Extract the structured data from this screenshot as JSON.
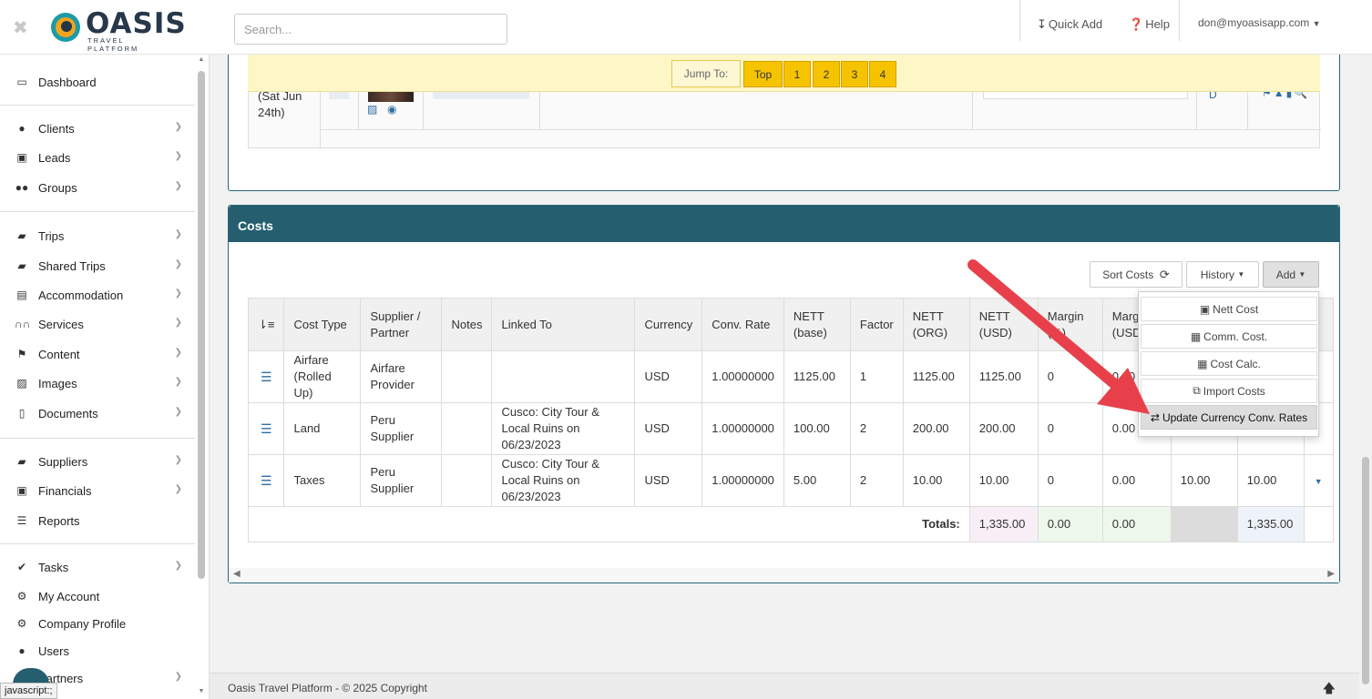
{
  "app": {
    "logo_text": "OASIS",
    "logo_sub": "TRAVEL PLATFORM"
  },
  "header": {
    "search_placeholder": "Search...",
    "quick_add": "Quick Add",
    "help": "Help",
    "user": "don@myoasisapp.com"
  },
  "sidebar": {
    "items": [
      {
        "label": "Dashboard",
        "icon": "monitor-icon"
      },
      {
        "label": "Clients",
        "icon": "user-icon"
      },
      {
        "label": "Leads",
        "icon": "inbox-icon"
      },
      {
        "label": "Groups",
        "icon": "users-icon"
      },
      {
        "label": "Trips",
        "icon": "suitcase-icon"
      },
      {
        "label": "Shared Trips",
        "icon": "suitcase-icon"
      },
      {
        "label": "Accommodation",
        "icon": "building-icon"
      },
      {
        "label": "Services",
        "icon": "binoculars-icon"
      },
      {
        "label": "Content",
        "icon": "flag-icon"
      },
      {
        "label": "Images",
        "icon": "image-icon"
      },
      {
        "label": "Documents",
        "icon": "file-pdf-icon"
      },
      {
        "label": "Suppliers",
        "icon": "suitcase-icon"
      },
      {
        "label": "Financials",
        "icon": "money-icon"
      },
      {
        "label": "Reports",
        "icon": "list-icon"
      },
      {
        "label": "Tasks",
        "icon": "check-icon"
      },
      {
        "label": "My Account",
        "icon": "gear-icon"
      },
      {
        "label": "Company Profile",
        "icon": "gears-icon"
      },
      {
        "label": "Users",
        "icon": "user-icon"
      },
      {
        "label": "Partners",
        "icon": "handshake-icon"
      }
    ]
  },
  "jump": {
    "label": "Jump To:",
    "buttons": [
      "Top",
      "1",
      "2",
      "3",
      "4"
    ]
  },
  "itinerary": {
    "date_line1": "(Sat Jun",
    "date_line2": "24th)"
  },
  "costs": {
    "title": "Costs",
    "sort_label": "Sort Costs",
    "history_label": "History",
    "add_label": "Add",
    "columns": [
      "Cost Type",
      "Supplier / Partner",
      "Notes",
      "Linked To",
      "Currency",
      "Conv. Rate",
      "NETT (base)",
      "Factor",
      "NETT (ORG)",
      "NETT (USD)",
      "Margin (%)",
      "Margin (USD)",
      "",
      ""
    ],
    "rows": [
      {
        "type": "Airfare (Rolled Up)",
        "supplier": "Airfare Provider",
        "notes": "",
        "linked": "",
        "currency": "USD",
        "rate": "1.00000000",
        "nett_base": "1125.00",
        "factor": "1",
        "nett_org": "1125.00",
        "nett_usd": "1125.00",
        "margin_pct": "0",
        "margin_usd": "0.00",
        "c13": "",
        "c14": ""
      },
      {
        "type": "Land",
        "supplier": "Peru Supplier",
        "notes": "",
        "linked": "Cusco: City Tour & Local Ruins on 06/23/2023",
        "currency": "USD",
        "rate": "1.00000000",
        "nett_base": "100.00",
        "factor": "2",
        "nett_org": "200.00",
        "nett_usd": "200.00",
        "margin_pct": "0",
        "margin_usd": "0.00",
        "c13": "",
        "c14": ""
      },
      {
        "type": "Taxes",
        "supplier": "Peru Supplier",
        "notes": "",
        "linked": "Cusco: City Tour & Local Ruins on 06/23/2023",
        "currency": "USD",
        "rate": "1.00000000",
        "nett_base": "5.00",
        "factor": "2",
        "nett_org": "10.00",
        "nett_usd": "10.00",
        "margin_pct": "0",
        "margin_usd": "0.00",
        "c13": "10.00",
        "c14": "10.00"
      }
    ],
    "totals": {
      "label": "Totals:",
      "nett": "1,335.00",
      "margin_pct": "0.00",
      "margin_usd": "0.00",
      "final": "1,335.00"
    }
  },
  "add_menu": {
    "items": [
      "Nett Cost",
      "Comm. Cost.",
      "Cost Calc.",
      "Import Costs",
      "Update Currency Conv. Rates"
    ]
  },
  "footer": {
    "text": "Oasis Travel Platform - © 2025 Copyright"
  },
  "status_tip": "javascript:;",
  "colors": {
    "accent": "#255f6f",
    "jump_yellow": "#f6c300",
    "arrow_red": "#e8404a"
  }
}
